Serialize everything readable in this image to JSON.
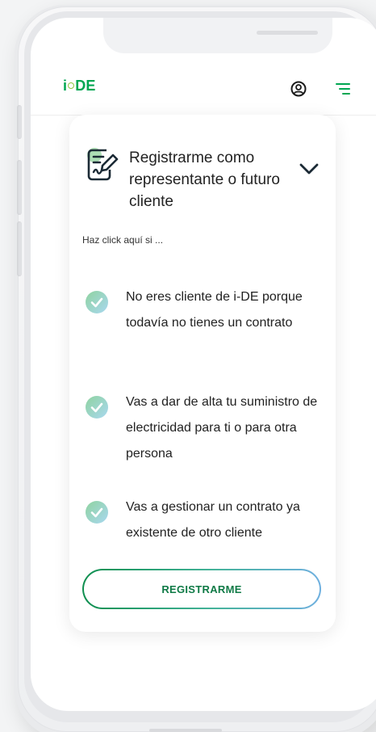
{
  "header": {
    "logo": {
      "prefix": "i",
      "suffix": "DE"
    },
    "icons": {
      "user": "user-circle-icon",
      "menu": "menu-icon"
    }
  },
  "card": {
    "icon": "signed-document-icon",
    "title": "Registrarme como representante o futuro cliente",
    "expand_icon": "chevron-down-icon",
    "hint": "Haz click aquí si ...",
    "items": [
      {
        "icon": "check-circle-icon",
        "text": "No eres cliente de i-DE porque todavía no tienes un contrato"
      },
      {
        "icon": "check-circle-icon",
        "text": "Vas a dar de alta tu suministro de electricidad para ti o para otra persona"
      },
      {
        "icon": "check-circle-icon",
        "text": "Vas a gestionar un contrato ya existente de otro cliente"
      }
    ],
    "button_label": "REGISTRARME"
  },
  "colors": {
    "brand_green": "#00a651",
    "accent_lime": "#8cc63f",
    "check_gradient_start": "#8fd3a0",
    "check_gradient_end": "#a9d8f0",
    "button_text": "#0f7a46"
  }
}
